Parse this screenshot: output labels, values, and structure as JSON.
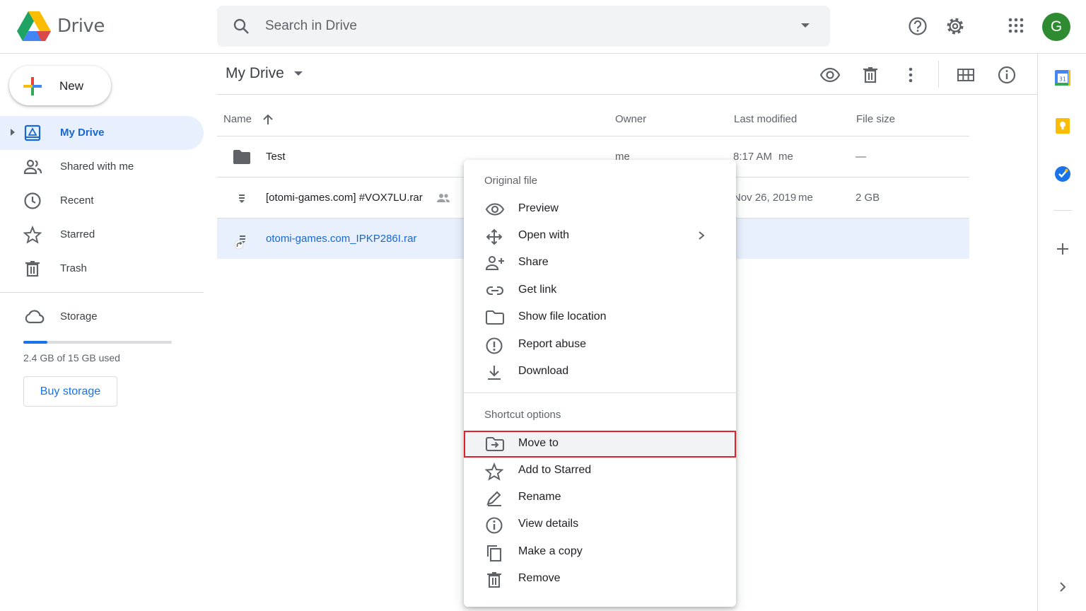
{
  "header": {
    "app_name": "Drive",
    "search_placeholder": "Search in Drive",
    "avatar_letter": "G"
  },
  "sidebar": {
    "new_label": "New",
    "items": [
      {
        "label": "My Drive",
        "icon": "my-drive-icon",
        "active": true
      },
      {
        "label": "Shared with me",
        "icon": "shared-icon"
      },
      {
        "label": "Recent",
        "icon": "clock-icon"
      },
      {
        "label": "Starred",
        "icon": "star-icon"
      },
      {
        "label": "Trash",
        "icon": "trash-icon"
      }
    ],
    "storage_label": "Storage",
    "storage_used_text": "2.4 GB of 15 GB used",
    "storage_used_fraction": 0.16,
    "buy_storage_label": "Buy storage"
  },
  "main": {
    "title": "My Drive",
    "columns": {
      "name": "Name",
      "owner": "Owner",
      "modified": "Last modified",
      "size": "File size"
    },
    "rows": [
      {
        "name": "Test",
        "owner": "me",
        "modified": "8:17 AM",
        "modified_by": "me",
        "size": "—",
        "icon": "folder-icon"
      },
      {
        "name": "[otomi-games.com] #VOX7LU.rar",
        "owner": "",
        "modified": "Nov 26, 2019",
        "modified_by": "me",
        "size": "2 GB",
        "icon": "archive-icon",
        "shared": true
      },
      {
        "name": "otomi-games.com_IPKP286I.rar",
        "owner": "",
        "modified": "",
        "modified_by": "",
        "size": "",
        "icon": "shortcut-archive-icon",
        "selected": true
      }
    ]
  },
  "context_menu": {
    "section1": "Original file",
    "items1": [
      "Preview",
      "Open with",
      "Share",
      "Get link",
      "Show file location",
      "Report abuse",
      "Download"
    ],
    "section2": "Shortcut options",
    "items2": [
      "Move to",
      "Add to Starred",
      "Rename",
      "View details",
      "Make a copy",
      "Remove"
    ],
    "highlighted": "Move to"
  },
  "colors": {
    "accent": "#1a73e8",
    "selected_bg": "#e8f0fe",
    "highlight_outline": "#e0202a"
  }
}
